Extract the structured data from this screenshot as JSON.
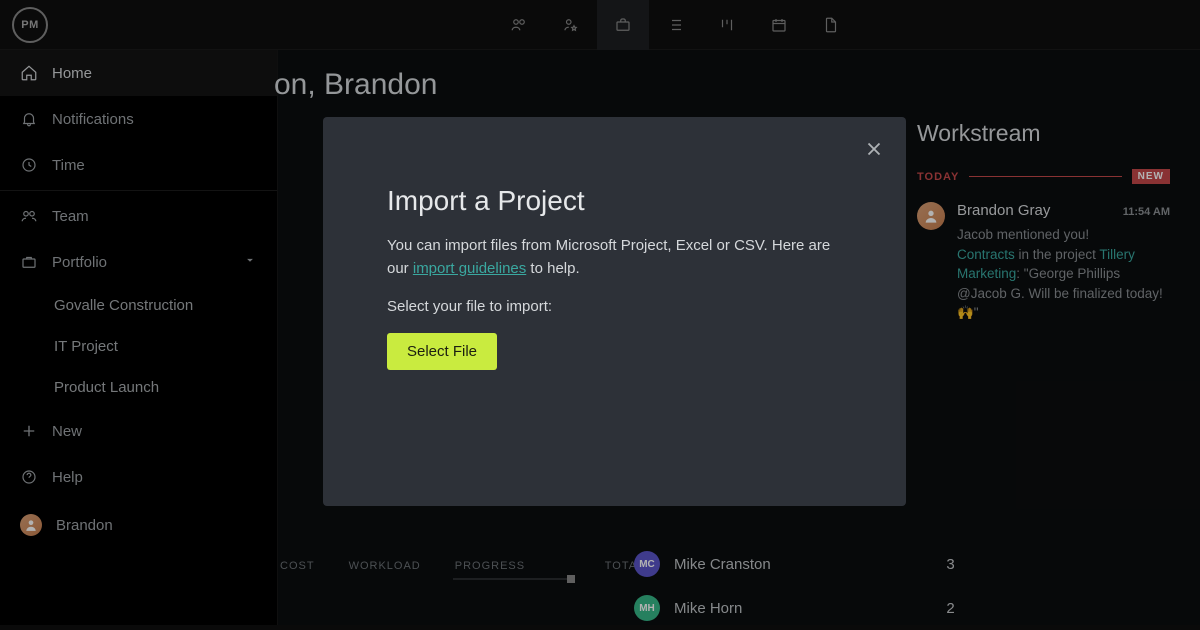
{
  "logo": "PM",
  "topbar_icons": [
    "people-pulse-icon",
    "people-star-icon",
    "briefcase-icon",
    "list-icon",
    "kanban-icon",
    "calendar-icon",
    "file-icon"
  ],
  "topbar_active": 2,
  "nav": [
    {
      "icon": "home-icon",
      "label": "Home",
      "active": true
    },
    {
      "icon": "bell-icon",
      "label": "Notifications"
    },
    {
      "icon": "clock-icon",
      "label": "Time"
    },
    {
      "separator": true
    },
    {
      "icon": "team-icon",
      "label": "Team"
    },
    {
      "icon": "portfolio-icon",
      "label": "Portfolio",
      "expandable": true,
      "children": [
        "Govalle Construction",
        "IT Project",
        "Product Launch"
      ]
    },
    {
      "icon": "plus-icon",
      "label": "New"
    },
    {
      "icon": "help-icon",
      "label": "Help"
    },
    {
      "icon": "avatar",
      "label": "Brandon"
    }
  ],
  "page_title": "on, Brandon",
  "stats": [
    "COST",
    "WORKLOAD",
    "PROGRESS",
    "TOTAL C"
  ],
  "team_list": [
    {
      "initials": "MC",
      "color": "#5b55c9",
      "name": "Mike Cranston",
      "count": 3
    },
    {
      "initials": "MH",
      "color": "#37b889",
      "name": "Mike Horn",
      "count": 2
    }
  ],
  "workstream": {
    "title": "Workstream",
    "today": "TODAY",
    "new": "NEW",
    "entry": {
      "name": "Brandon Gray",
      "time": "11:54 AM",
      "mention_line": "Jacob mentioned you!",
      "link1": "Contracts",
      "mid1": " in the project ",
      "link2": "Tillery Marketing",
      "tail": ": \"George Phillips @Jacob G. Will be finalized today! 🙌\""
    }
  },
  "modal": {
    "title": "Import a Project",
    "body_pre": "You can import files from Microsoft Project, Excel or CSV. Here are our ",
    "body_link": "import guidelines",
    "body_post": " to help.",
    "select_label": "Select your file to import:",
    "button": "Select File"
  }
}
